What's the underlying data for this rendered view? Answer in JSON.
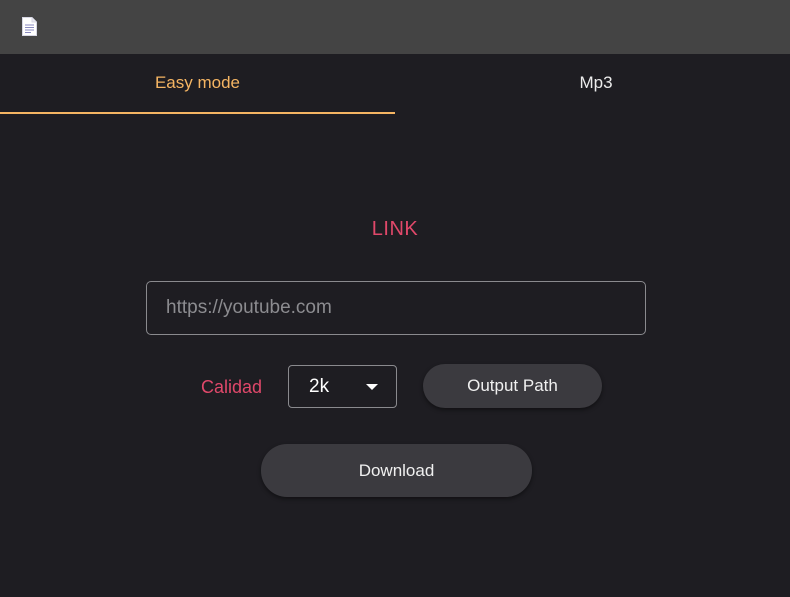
{
  "titlebar": {
    "icon": "document-icon"
  },
  "tabs": [
    {
      "label": "Easy mode",
      "active": true
    },
    {
      "label": "Mp3",
      "active": false
    }
  ],
  "colors": {
    "accent": "#f5b563",
    "label": "#e0486a",
    "background": "#1e1d22",
    "titlebar": "#444444",
    "button": "#3b3a3f"
  },
  "main": {
    "link_label": "LINK",
    "url_input": {
      "value": "",
      "placeholder": "https://youtube.com"
    },
    "quality": {
      "label": "Calidad",
      "selected": "2k"
    },
    "output_path_label": "Output Path",
    "download_label": "Download"
  }
}
